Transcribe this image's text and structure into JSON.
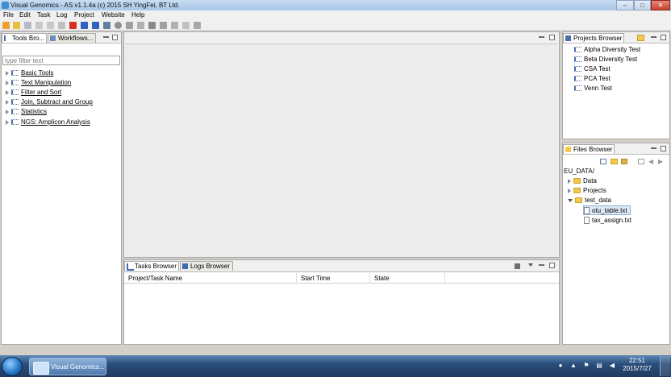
{
  "window": {
    "title": "Visual Genomics - AS v1.1.4a (c) 2015 SH YingFei, BT Ltd."
  },
  "menu": [
    "File",
    "Edit",
    "Task",
    "Log",
    "Project",
    "Website",
    "Help"
  ],
  "left_panel": {
    "tabs": [
      "Tools Bro...",
      "Workflows..."
    ],
    "filter_placeholder": "type filter text",
    "items": [
      "Basic Tools",
      "Text Manipulation",
      "Filter and Sort",
      "Join, Subtract and Group",
      "Statistics",
      "NGS: Amplicon Analysis"
    ]
  },
  "projects_browser": {
    "tab": "Projects Browser",
    "items": [
      "Alpha Diversity Test",
      "Beta Diversity Test",
      "CSA Test",
      "PCA Test",
      "Venn Test"
    ]
  },
  "files_browser": {
    "tab": "Files Browser",
    "root": "EU_DATA/",
    "folders": [
      "Data",
      "Projects",
      "test_data"
    ],
    "files": [
      "otu_table.txt",
      "tax_assign.txt"
    ]
  },
  "bottom_panel": {
    "tabs": [
      "Tasks Browser",
      "Logs Browser"
    ],
    "columns": [
      "Project/Task Name",
      "Start Time",
      "State"
    ]
  },
  "taskbar": {
    "task_button": "Visual Genomics...",
    "time": "22:51",
    "date": "2015/7/27"
  }
}
